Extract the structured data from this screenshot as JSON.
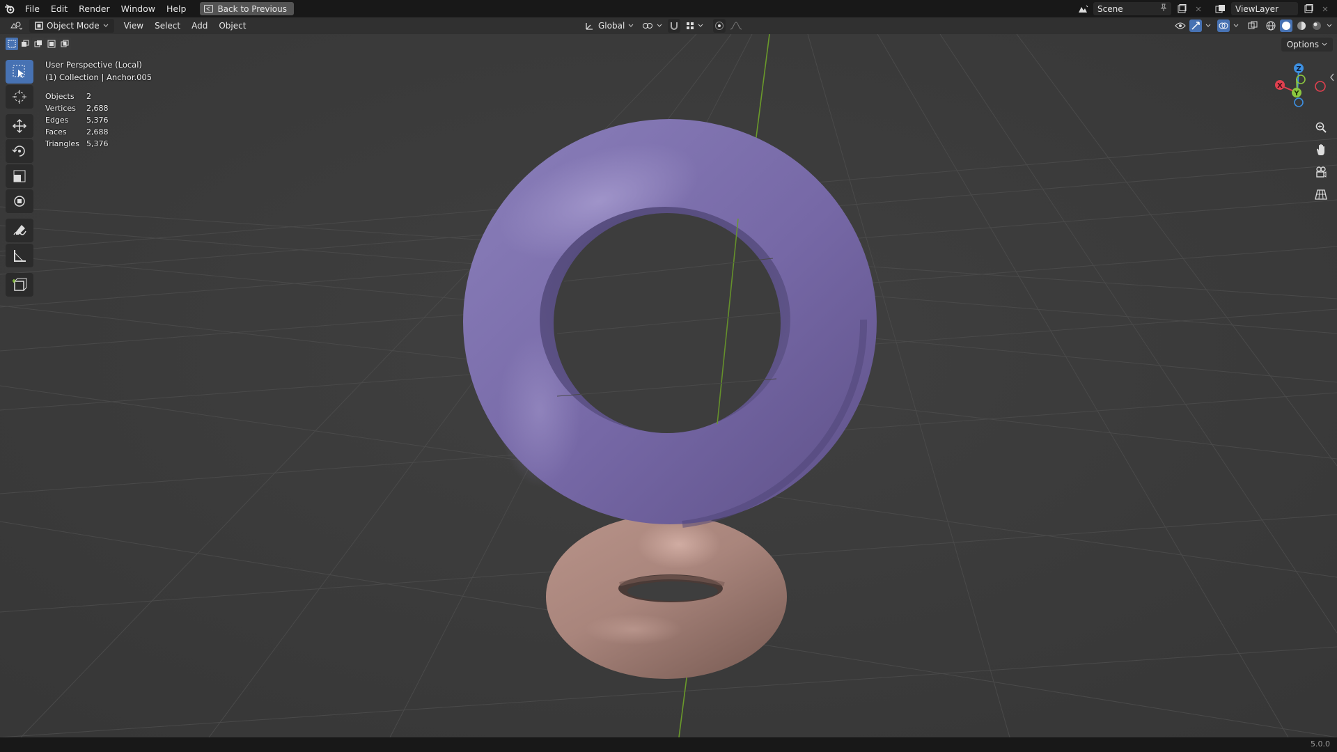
{
  "menu": {
    "items": [
      "File",
      "Edit",
      "Render",
      "Window",
      "Help"
    ],
    "back_label": "Back to Previous"
  },
  "topbar_right": {
    "scene_label": "Scene",
    "viewlayer_label": "ViewLayer"
  },
  "header": {
    "mode_label": "Object Mode",
    "menus": [
      "View",
      "Select",
      "Add",
      "Object"
    ],
    "transform_orientation": "Global"
  },
  "viewport": {
    "options_label": "Options",
    "view_name": "User Perspective (Local)",
    "collection_info": "(1) Collection | Anchor.005",
    "stats": [
      {
        "key": "Objects",
        "value": "2"
      },
      {
        "key": "Vertices",
        "value": "2,688"
      },
      {
        "key": "Edges",
        "value": "5,376"
      },
      {
        "key": "Faces",
        "value": "2,688"
      },
      {
        "key": "Triangles",
        "value": "5,376"
      }
    ],
    "gizmo_axes": {
      "x": "X",
      "y": "Y",
      "z": "Z"
    }
  },
  "toolbar": {
    "tools": [
      "select-box-icon",
      "cursor-icon",
      "move-icon",
      "rotate-icon",
      "scale-icon",
      "transform-icon",
      "annotate-icon",
      "measure-icon",
      "add-cube-icon"
    ]
  },
  "statusbar": {
    "version": "5.0.0"
  },
  "colors": {
    "accent": "#4772b3",
    "torus_large": "#7a6ea8",
    "torus_small": "#a98780",
    "axis_x": "#e0404f",
    "axis_y": "#8cc63f",
    "axis_z": "#3d8fe0",
    "y_axis_line": "#6a9a2a"
  }
}
